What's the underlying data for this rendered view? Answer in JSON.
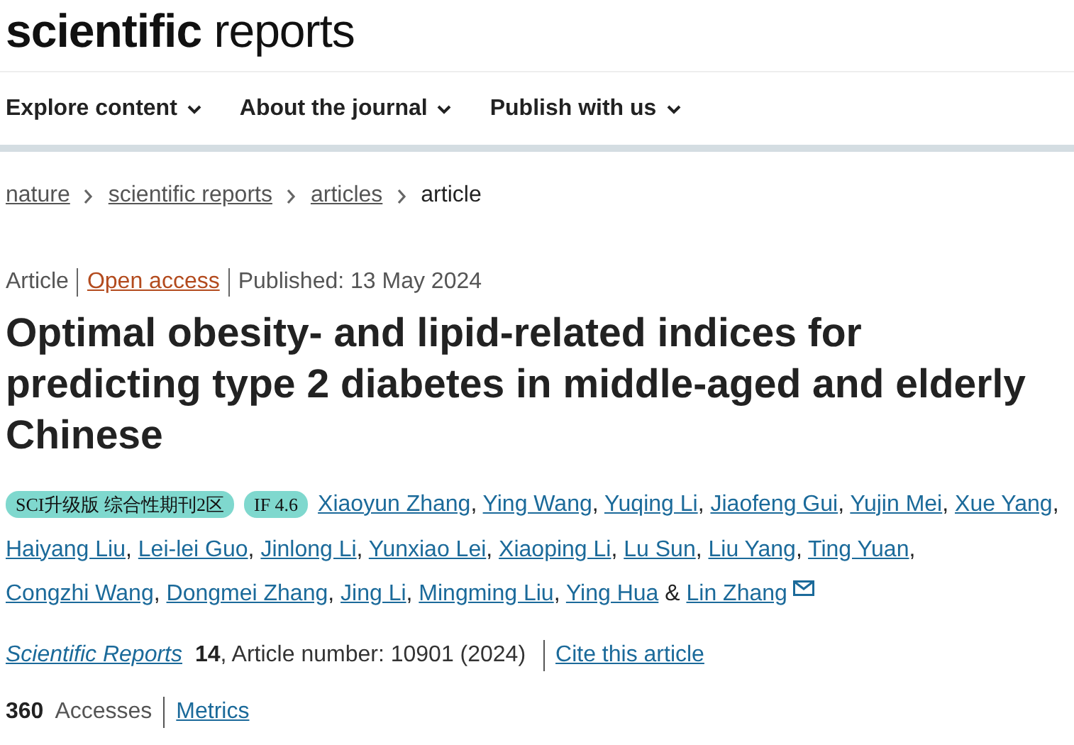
{
  "logo": "**scientific** reports",
  "nav": [
    {
      "label": "Explore content",
      "dropdown": true
    },
    {
      "label": "About the journal",
      "dropdown": true
    },
    {
      "label": "Publish with us",
      "dropdown": true
    }
  ],
  "breadcrumbs": [
    {
      "label": "nature",
      "link": true
    },
    {
      "label": "scientific reports",
      "link": true
    },
    {
      "label": "articles",
      "link": true
    },
    {
      "label": "article",
      "link": false
    }
  ],
  "meta": {
    "type": "Article",
    "access": "Open access",
    "published": "Published: 13 May 2024"
  },
  "title": "Optimal obesity- and lipid-related indices for predicting type 2 diabetes in middle-aged and elderly Chinese",
  "badges": [
    "SCI升级版 综合性期刊2区",
    "IF 4.6"
  ],
  "authors": [
    {
      "name": "Xiaoyun Zhang",
      "after": ","
    },
    {
      "name": "Ying Wang",
      "after": ","
    },
    {
      "name": "Yuqing Li",
      "after": ","
    },
    {
      "name": "Jiaofeng Gui",
      "after": ","
    },
    {
      "name": "Yujin Mei",
      "after": ","
    },
    {
      "name": "Xue Yang",
      "after": ","
    },
    {
      "name": "Haiyang Liu",
      "after": ","
    },
    {
      "name": "Lei-lei Guo",
      "after": ","
    },
    {
      "name": "Jinlong Li",
      "after": ","
    },
    {
      "name": "Yunxiao Lei",
      "after": ","
    },
    {
      "name": "Xiaoping Li",
      "after": ","
    },
    {
      "name": "Lu Sun",
      "after": ","
    },
    {
      "name": "Liu Yang",
      "after": ","
    },
    {
      "name": "Ting Yuan",
      "after": ","
    },
    {
      "name": "Congzhi Wang",
      "after": ","
    },
    {
      "name": "Dongmei Zhang",
      "after": ","
    },
    {
      "name": "Jing Li",
      "after": ","
    },
    {
      "name": "Mingming Liu",
      "after": ","
    },
    {
      "name": "Ying Hua",
      "after": "&"
    },
    {
      "name": "Lin Zhang",
      "mail": true
    }
  ],
  "citation": {
    "journal": "Scientific Reports",
    "volume": "14",
    "article_number": ", Article number: 10901 (2024)",
    "cite": "Cite this article"
  },
  "metrics": {
    "count": "360",
    "label": "Accesses",
    "link": "Metrics"
  }
}
